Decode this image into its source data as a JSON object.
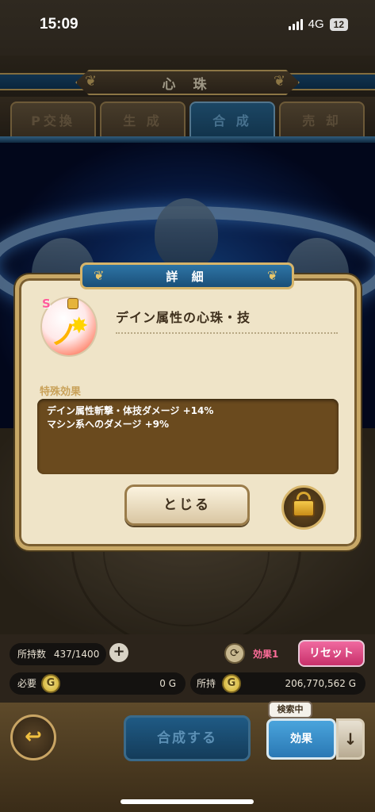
{
  "status": {
    "time": "15:09",
    "network": "4G",
    "battery": "12"
  },
  "screen": {
    "title": "心 珠"
  },
  "tabs": [
    {
      "label": "P交換"
    },
    {
      "label": "生 成"
    },
    {
      "label": "合 成"
    },
    {
      "label": "売 却"
    }
  ],
  "dialog": {
    "title": "詳 細",
    "item": {
      "rank": "S",
      "name": "デイン属性の心珠・技"
    },
    "section_label": "特殊効果",
    "effects": [
      "デイン属性斬撃・体技ダメージ +14%",
      "マシン系へのダメージ +9%"
    ],
    "close_label": "とじる"
  },
  "inventory": {
    "held_label": "所持数",
    "held_value": "437/1400",
    "effect_filter": "効果1",
    "reset_label": "リセット",
    "cost_label": "必要",
    "cost_value": "0 G",
    "gold_label": "所持",
    "gold_value": "206,770,562 G",
    "coin_glyph": "G"
  },
  "footer": {
    "compose_label": "合成する",
    "searching_badge": "検索中",
    "filter_label": "効果",
    "back_glyph": "↩",
    "sort_glyph": "↓"
  },
  "colors": {
    "accent_blue": "#2e75a6",
    "parchment": "#efe4c8",
    "gold": "#d7b56a",
    "reset_pink": "#f06aa0"
  }
}
